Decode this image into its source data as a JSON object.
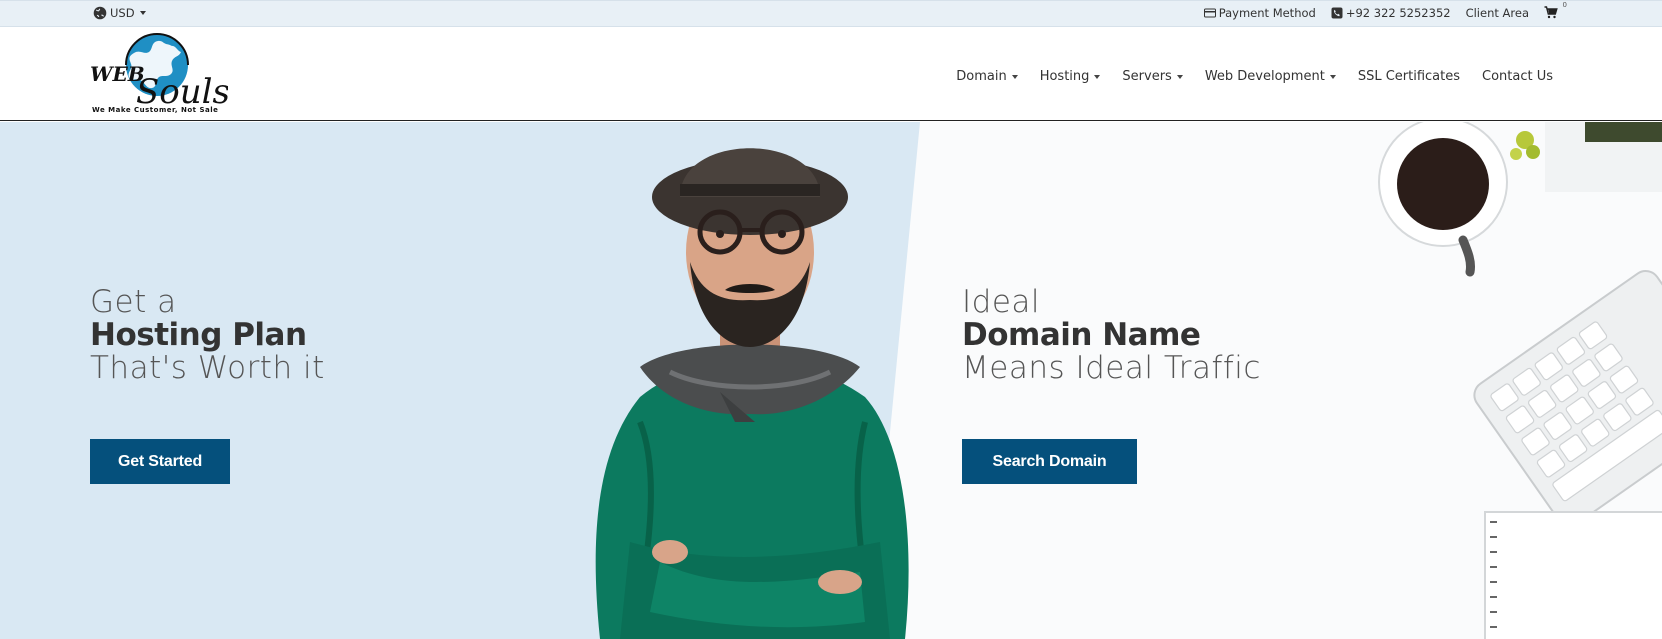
{
  "topbar": {
    "currency": "USD",
    "payment_method": "Payment Method",
    "phone": "+92 322 5252352",
    "client_area": "Client Area",
    "cart_count": "0"
  },
  "header": {
    "logo_web": "WEB",
    "logo_souls": "Souls",
    "logo_tagline": "We Make Customer, Not Sale",
    "nav": [
      {
        "label": "Domain",
        "dropdown": true
      },
      {
        "label": "Hosting",
        "dropdown": true
      },
      {
        "label": "Servers",
        "dropdown": true
      },
      {
        "label": "Web Development",
        "dropdown": true
      },
      {
        "label": "SSL Certificates",
        "dropdown": false
      },
      {
        "label": "Contact Us",
        "dropdown": false
      }
    ]
  },
  "hero": {
    "left": {
      "line1": "Get a",
      "line2": "Hosting Plan",
      "line3": "That's Worth it",
      "button": "Get Started"
    },
    "right": {
      "line1": "Ideal",
      "line2": "Domain Name",
      "line3": "Means Ideal Traffic",
      "button": "Search Domain"
    }
  },
  "colors": {
    "topbar_bg": "#e8f0f6",
    "hero_left_bg": "#d9e8f3",
    "button_bg": "#05507c",
    "logo_globe": "#1f8fc4"
  }
}
